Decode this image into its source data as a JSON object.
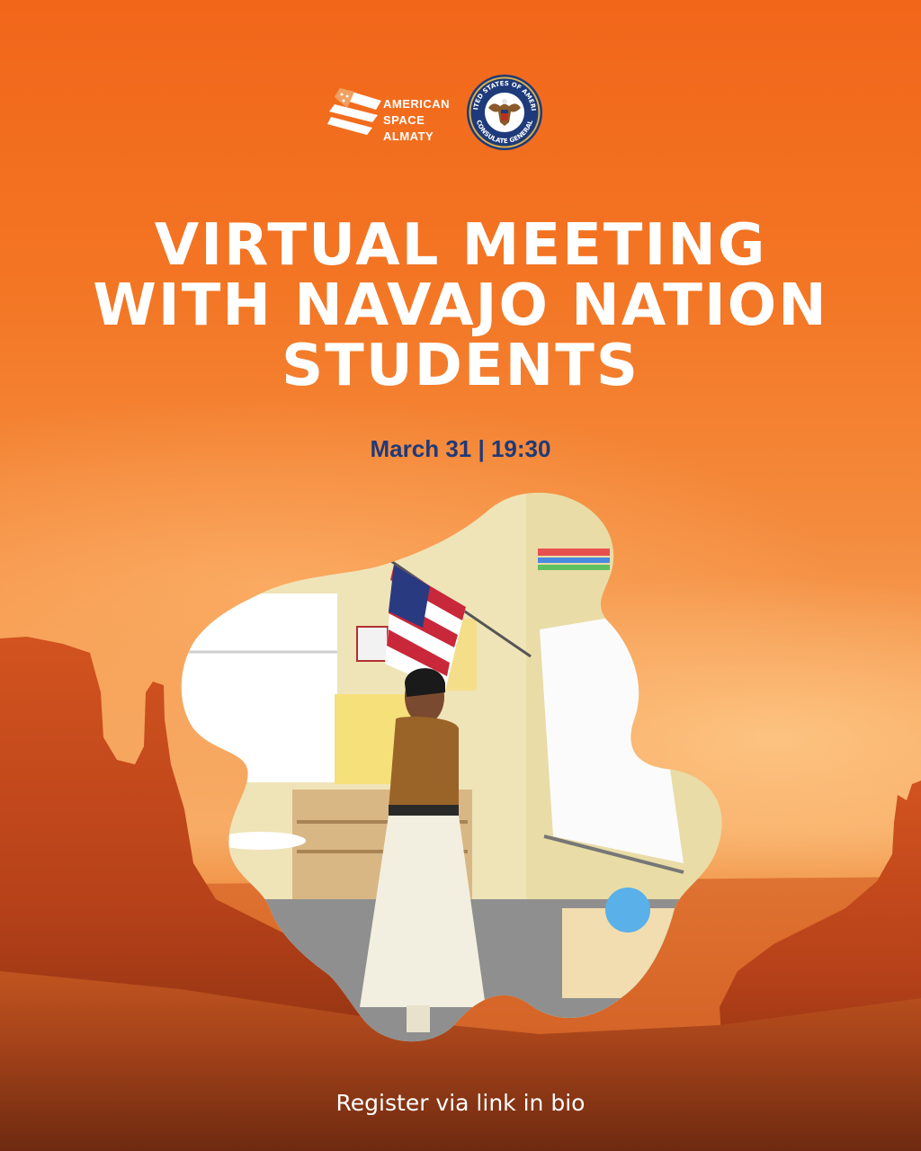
{
  "logos": {
    "american_space": {
      "line1": "AMERICAN",
      "line2": "SPACE",
      "line3": "ALMATY"
    },
    "seal": {
      "top_text": "UNITED STATES OF AMERICA",
      "bottom_text": "CONSULATE GENERAL"
    }
  },
  "title": {
    "line1": "VIRTUAL MEETING",
    "line2": "WITH NAVAJO NATION",
    "line3": "STUDENTS"
  },
  "date_time": "March 31 | 19:30",
  "cta": "Register via link in bio",
  "colors": {
    "background_orange": "#f27a2a",
    "title_text": "#ffffff",
    "date_text": "#1f3a78",
    "rock_red": "#b8421a"
  }
}
